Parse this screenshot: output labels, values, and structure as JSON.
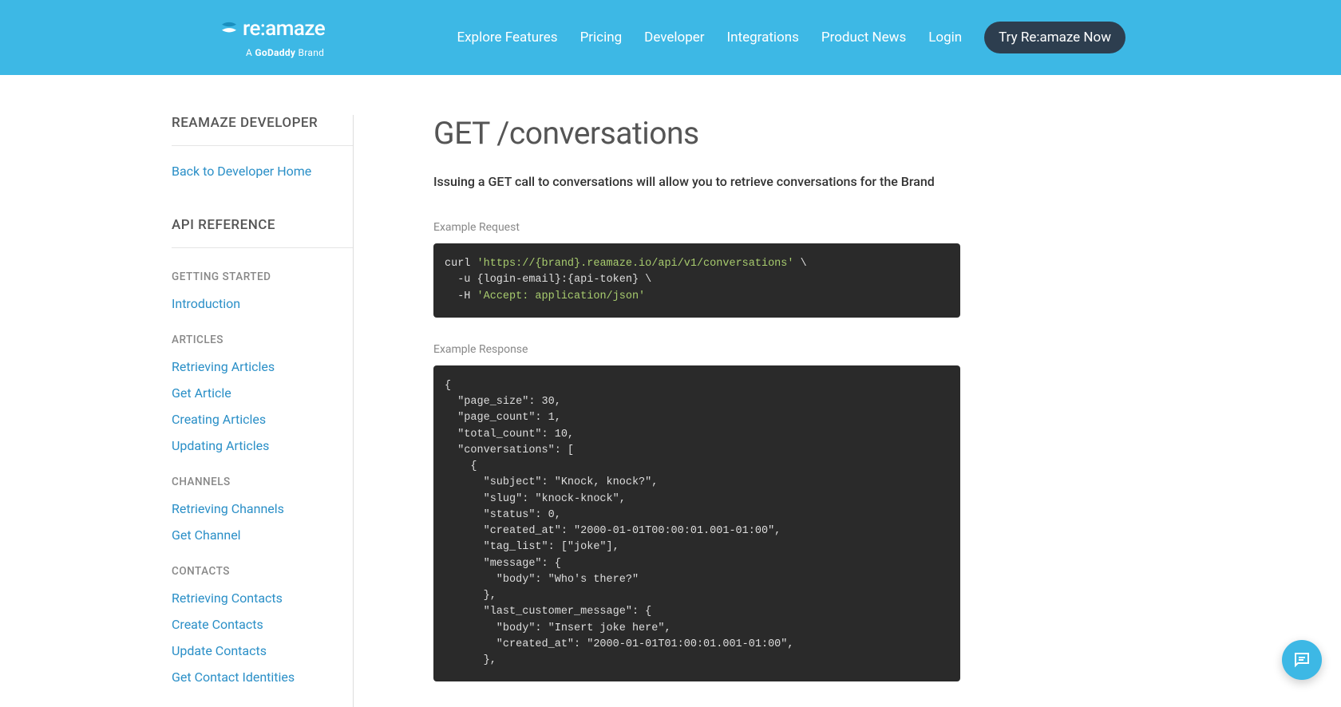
{
  "header": {
    "logo_text": "re:amaze",
    "logo_sub_prefix": "A ",
    "logo_sub_brand": "GoDaddy",
    "logo_sub_suffix": " Brand",
    "nav": [
      "Explore Features",
      "Pricing",
      "Developer",
      "Integrations",
      "Product News",
      "Login"
    ],
    "cta": "Try Re:amaze Now"
  },
  "sidebar": {
    "title": "REAMAZE DEVELOPER",
    "back_link": "Back to Developer Home",
    "api_ref_title": "API REFERENCE",
    "groups": [
      {
        "heading": "GETTING STARTED",
        "items": [
          "Introduction"
        ]
      },
      {
        "heading": "ARTICLES",
        "items": [
          "Retrieving Articles",
          "Get Article",
          "Creating Articles",
          "Updating Articles"
        ]
      },
      {
        "heading": "CHANNELS",
        "items": [
          "Retrieving Channels",
          "Get Channel"
        ]
      },
      {
        "heading": "CONTACTS",
        "items": [
          "Retrieving Contacts",
          "Create Contacts",
          "Update Contacts",
          "Get Contact Identities"
        ]
      }
    ]
  },
  "main": {
    "title": "GET /conversations",
    "lead": "Issuing a GET call to conversations will allow you to retrieve conversations for the Brand",
    "req_label": "Example Request",
    "req_line1_a": "curl ",
    "req_line1_b": "'https://{brand}.reamaze.io/api/v1/conversations'",
    "req_line1_c": " \\",
    "req_line2": "  -u {login-email}:{api-token} \\",
    "req_line3_a": "  -H ",
    "req_line3_b": "'Accept: application/json'",
    "res_label": "Example Response",
    "res_body": "{\n  \"page_size\": 30,\n  \"page_count\": 1,\n  \"total_count\": 10,\n  \"conversations\": [\n    {\n      \"subject\": \"Knock, knock?\",\n      \"slug\": \"knock-knock\",\n      \"status\": 0,\n      \"created_at\": \"2000-01-01T00:00:01.001-01:00\",\n      \"tag_list\": [\"joke\"],\n      \"message\": {\n        \"body\": \"Who's there?\"\n      },\n      \"last_customer_message\": {\n        \"body\": \"Insert joke here\",\n        \"created_at\": \"2000-01-01T01:00:01.001-01:00\",\n      },"
  }
}
